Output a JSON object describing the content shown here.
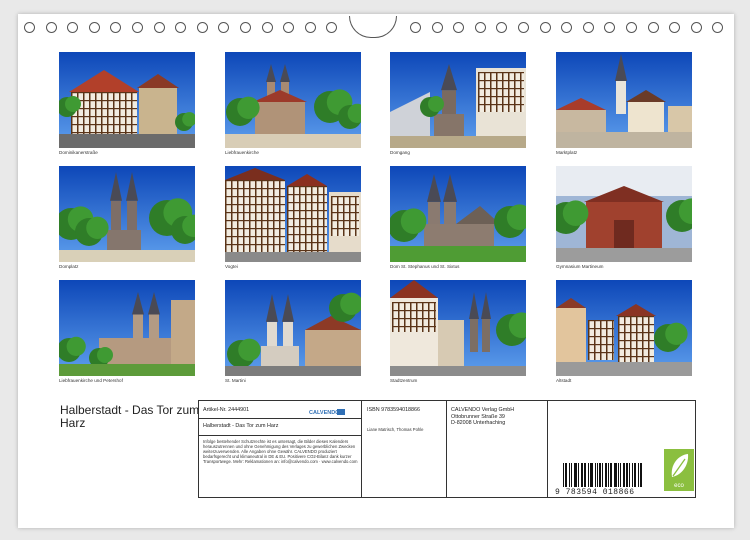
{
  "calendar": {
    "title": "Halberstadt - Das Tor zum Harz"
  },
  "photos": [
    {
      "caption": "Dominikanerstraße",
      "scene": "halftimber"
    },
    {
      "caption": "Liebfrauenkirche",
      "scene": "church"
    },
    {
      "caption": "Domgang",
      "scene": "gothic"
    },
    {
      "caption": "Marktplatz",
      "scene": "square"
    },
    {
      "caption": "Domplatz",
      "scene": "twinspire"
    },
    {
      "caption": "Vogtei",
      "scene": "halftimber2"
    },
    {
      "caption": "Dom St. Stephanus und St. Sixtus",
      "scene": "cathedral"
    },
    {
      "caption": "Gymnasium Martineum",
      "scene": "brick"
    },
    {
      "caption": "Liebfrauenkirche und Petershof",
      "scene": "romanesque"
    },
    {
      "caption": "St. Martini",
      "scene": "martini"
    },
    {
      "caption": "Stadtzentrum",
      "scene": "street"
    },
    {
      "caption": "Altstadt",
      "scene": "oldtown"
    }
  ],
  "info": {
    "article_label": "Artikel-Nr. 2444901",
    "publisher_logo": "CALVENDO",
    "calendar_title": "Halberstadt - Das Tor zum Harz",
    "legal_text": "Infolge bestehender Schutzrechte ist es untersagt, die Bilder dieses Kalenders herauszutrennen und ohne Genehmigung des Verlages zu gewerblichen Zwecken weiterzuverwenden. Alle Angaben ohne Gewähr. CALVENDO produziert bedarfsgerecht und klimaneutral in DE & EU. Positivere CO2-Bilanz dank kurzer Transportwege. Mehr: Reklamationen an: info@calvendo.com · www.calvendo.com",
    "isbn": "ISBN 9783594018866",
    "authors": "Liane Matrisch, Thomas Pohle",
    "publisher_name": "CALVENDO Verlag GmbH",
    "publisher_street": "Ottobrunner Straße 39",
    "publisher_city": "D-82008 Unterhaching",
    "barcode_digits": "9  783594  018866",
    "eco_label": "eco"
  },
  "colors": {
    "sky": "#1e5fc4",
    "grass": "#3f8f2c",
    "eco_green": "#8bbf3f"
  }
}
